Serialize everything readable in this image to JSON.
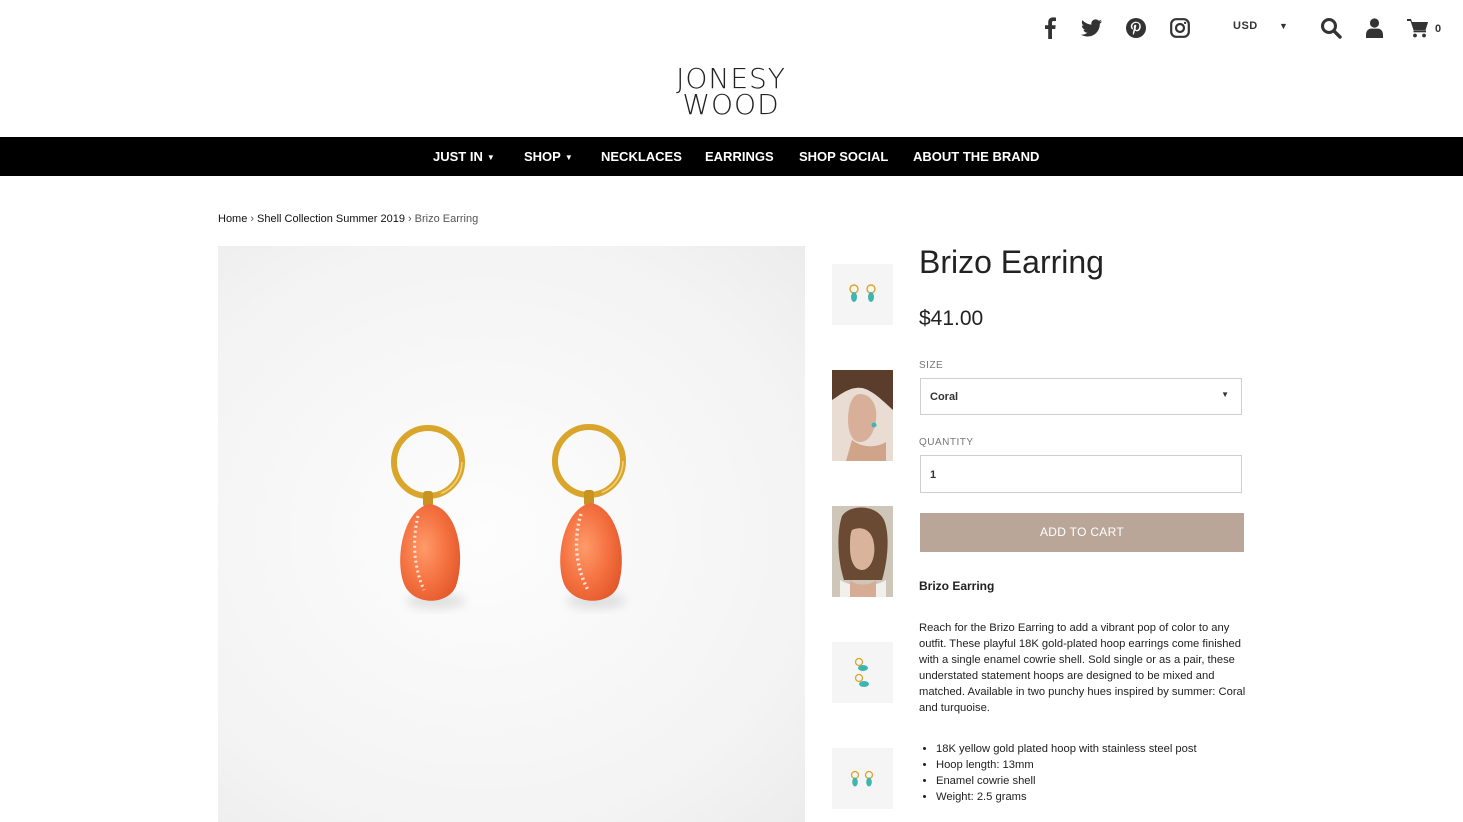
{
  "header": {
    "social": [
      "facebook-icon",
      "twitter-icon",
      "pinterest-icon",
      "instagram-icon"
    ],
    "currency": "USD",
    "cart_count": "0"
  },
  "logo": {
    "line1": "JONESY",
    "line2": "WOOD"
  },
  "nav": {
    "items": [
      {
        "label": "JUST IN",
        "dropdown": true
      },
      {
        "label": "SHOP",
        "dropdown": true
      },
      {
        "label": "NECKLACES"
      },
      {
        "label": "EARRINGS"
      },
      {
        "label": "SHOP SOCIAL"
      },
      {
        "label": "ABOUT THE BRAND"
      }
    ]
  },
  "breadcrumb": {
    "home": "Home",
    "collection": "Shell Collection Summer 2019",
    "current": "Brizo Earring"
  },
  "product": {
    "title": "Brizo Earring",
    "price": "$41.00",
    "size_label": "SIZE",
    "size_value": "Coral",
    "quantity_label": "QUANTITY",
    "quantity_value": "1",
    "add_to_cart": "ADD TO CART",
    "description_title": "Brizo Earring",
    "description": "Reach for the Brizo Earring to add a vibrant pop of color to any outfit. These playful 18K gold-plated hoop earrings come finished with a single enamel cowrie shell. Sold single or as a pair, these understated statement hoops are designed to be mixed and matched. Available in two punchy hues inspired by summer: Coral and turquoise.",
    "features": [
      "18K yellow gold plated hoop with stainless steel post",
      "Hoop length: 13mm",
      "Enamel cowrie shell",
      "Weight: 2.5 grams"
    ]
  },
  "colors": {
    "nav_bg": "#000000",
    "button": "#b9a699",
    "shell_coral": "#f47a4a",
    "shell_turquoise": "#3fb5b0",
    "gold": "#d9a52a"
  }
}
